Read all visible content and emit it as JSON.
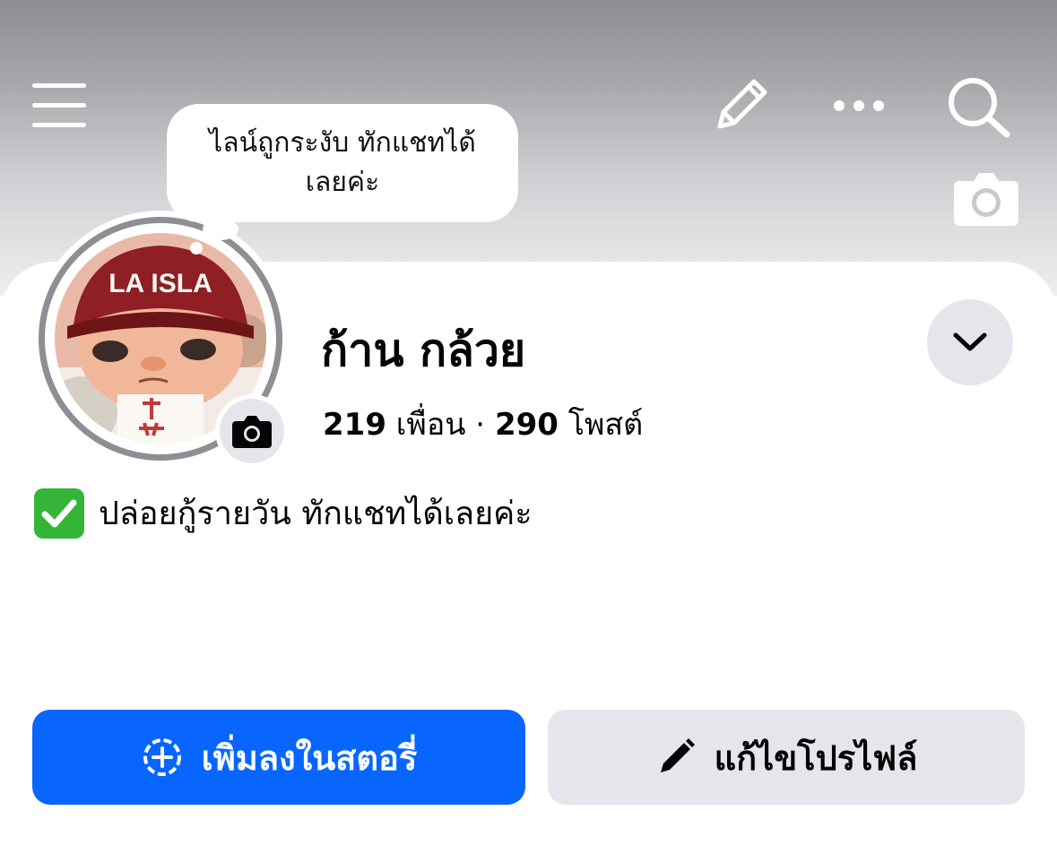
{
  "status_bubble": {
    "line1": "ไลน์ถูกระงับ ทักแชทได้",
    "line2": "เลยค่ะ"
  },
  "avatar": {
    "cap_text": "LA ISLA"
  },
  "profile": {
    "name": "ก้าน กล้วย",
    "friends_count": "219",
    "friends_label": "เพื่อน",
    "separator": " · ",
    "posts_count": "290",
    "posts_label": "โพสต์"
  },
  "bio": {
    "text": "ปล่อยกู้รายวัน ทักแชทได้เลยค่ะ"
  },
  "actions": {
    "add_story_label": "เพิ่มลงในสตอรี่",
    "edit_profile_label": "แก้ไขโปรไฟล์"
  },
  "icons": {
    "menu": "hamburger-icon",
    "edit": "pencil-icon",
    "more": "more-dots-icon",
    "search": "search-icon",
    "cover_camera": "camera-icon",
    "avatar_camera": "camera-icon",
    "dropdown": "chevron-down-icon",
    "bio": "check-mark-icon",
    "story": "add-circle-icon",
    "edit_profile": "pencil-icon"
  },
  "colors": {
    "primary_button": "#0866ff",
    "secondary_button": "#e4e6eb",
    "check_green": "#35b537"
  }
}
